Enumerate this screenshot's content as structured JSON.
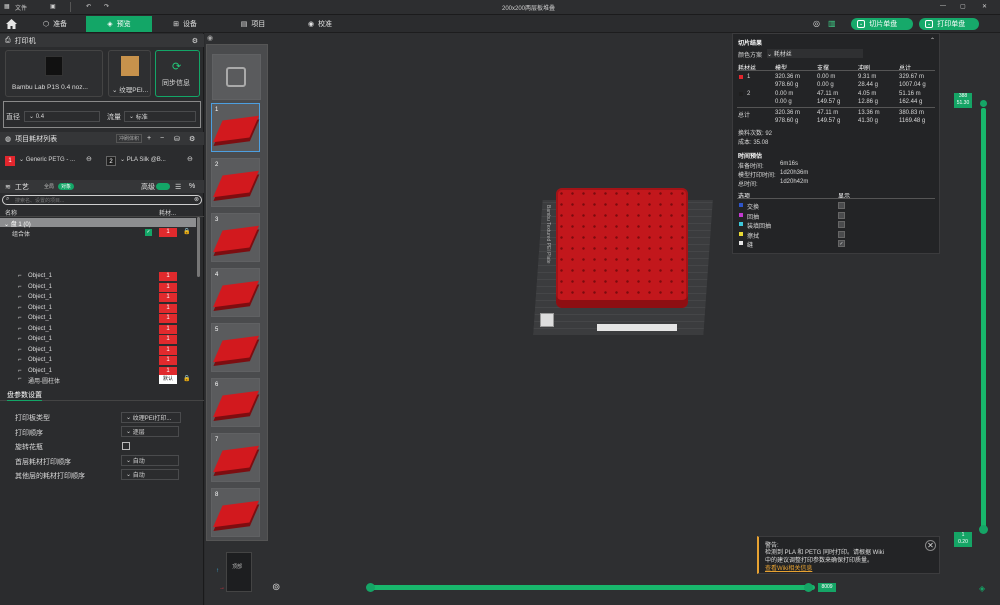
{
  "titlebar": {
    "file_menu": "文件",
    "window_title": "200x200两层板堆叠"
  },
  "menubar": {
    "tabs": [
      {
        "label": "准备"
      },
      {
        "label": "预览"
      },
      {
        "label": "设备"
      },
      {
        "label": "项目"
      },
      {
        "label": "校准"
      }
    ],
    "slice_button": "切片单盘",
    "print_button": "打印单盘"
  },
  "printer": {
    "section_title": "打印机",
    "printer_name": "Bambu Lab P1S 0.4 noz...",
    "plate_type": "纹理PEI...",
    "sync_label": "同步信息",
    "diameter_label": "直径",
    "diameter_value": "0.4",
    "flow_label": "流量",
    "flow_value": "标准"
  },
  "filaments": {
    "section_title": "项目耗材列表",
    "flush_button": "冲刷体积",
    "items": [
      {
        "index": "1",
        "name": "Generic PETG - ...",
        "color": "#e3262d"
      },
      {
        "index": "2",
        "name": "PLA Silk @B...",
        "color": "#1f1f1f"
      }
    ]
  },
  "process": {
    "section_title": "工艺",
    "global_label": "全局",
    "object_label": "对象",
    "advanced_label": "高级",
    "search_placeholder": "搜索名、设置的项目...",
    "col_name": "名称",
    "col_filament": "耗材...",
    "plate_label": "盘 1 (0)",
    "group_label": "组合体",
    "group_filament": "1",
    "objects": [
      "Object_1",
      "Object_1",
      "Object_1",
      "Object_1",
      "Object_1",
      "Object_1",
      "Object_1",
      "Object_1",
      "Object_1",
      "Object_1"
    ],
    "object_filament": "1",
    "support_label": "通用-圆柱体",
    "support_value": "默认"
  },
  "plate_settings": {
    "title": "盘参数设置",
    "rows": [
      {
        "label": "打印板类型",
        "value": "纹理PEI打印..."
      },
      {
        "label": "打印顺序",
        "value": "逐层"
      },
      {
        "label": "旋转花瓶",
        "value": ""
      },
      {
        "label": "首层耗材打印顺序",
        "value": "自动"
      },
      {
        "label": "其他层的耗材打印顺序",
        "value": "自动"
      }
    ]
  },
  "layers": {
    "thumbnails": [
      "1",
      "2",
      "3",
      "4",
      "5",
      "6",
      "7",
      "8"
    ]
  },
  "slice_result": {
    "title": "切片结果",
    "scheme_label": "颜色方案",
    "scheme_value": "耗材丝",
    "headers": [
      "耗材丝",
      "模型",
      "支撑",
      "冲刷",
      "总计"
    ],
    "rows": [
      {
        "id": "1",
        "color": "#e3262d",
        "model": [
          "320.36 m",
          "978.60 g"
        ],
        "support": [
          "0.00 m",
          "0.00 g"
        ],
        "flush": [
          "9.31 m",
          "28.44 g"
        ],
        "total": [
          "329.67 m",
          "1007.04 g"
        ]
      },
      {
        "id": "2",
        "color": "#1f1f1f",
        "model": [
          "0.00 m",
          "0.00 g"
        ],
        "support": [
          "47.11 m",
          "149.57 g"
        ],
        "flush": [
          "4.05 m",
          "12.86 g"
        ],
        "total": [
          "51.16 m",
          "162.44 g"
        ]
      },
      {
        "id": "总计",
        "color": "",
        "model": [
          "320.36 m",
          "978.60 g"
        ],
        "support": [
          "47.11 m",
          "149.57 g"
        ],
        "flush": [
          "13.36 m",
          "41.30 g"
        ],
        "total": [
          "380.83 m",
          "1169.48 g"
        ]
      }
    ],
    "swaps": "换料次数:  92",
    "cost": "成本:  35.08",
    "time_title": "时间预估",
    "prep_label": "准备时间:",
    "prep_value": "6m16s",
    "model_time_label": "模型打印时间:",
    "model_time_value": "1d20h36m",
    "total_time_label": "总时间:",
    "total_time_value": "1d20h42m",
    "options_header": "选项",
    "display_header": "显示",
    "options": [
      {
        "label": "交换",
        "color": "#2e55c8",
        "checked": false
      },
      {
        "label": "回抽",
        "color": "#c33ad0",
        "checked": false
      },
      {
        "label": "装填回抽",
        "color": "#3dc7d9",
        "checked": false
      },
      {
        "label": "擦拭",
        "color": "#e8d934",
        "checked": false
      },
      {
        "label": "缝",
        "color": "#e6e6e6",
        "checked": true
      }
    ]
  },
  "slider": {
    "top_value1": "388",
    "top_value2": "51.30",
    "bottom_value1": "1",
    "bottom_value2": "0.20",
    "h_value": "8009"
  },
  "bed_label": "Bambu Textured PEI Plate",
  "view_cube_label": "顶部",
  "warning": {
    "title": "警告:",
    "line1": "检测到 PLA 和 PETG 同时打印。请根据 Wiki",
    "line2": "中的建议调整打印参数来确保打印质量。",
    "link": "查看Wiki相关信息"
  }
}
